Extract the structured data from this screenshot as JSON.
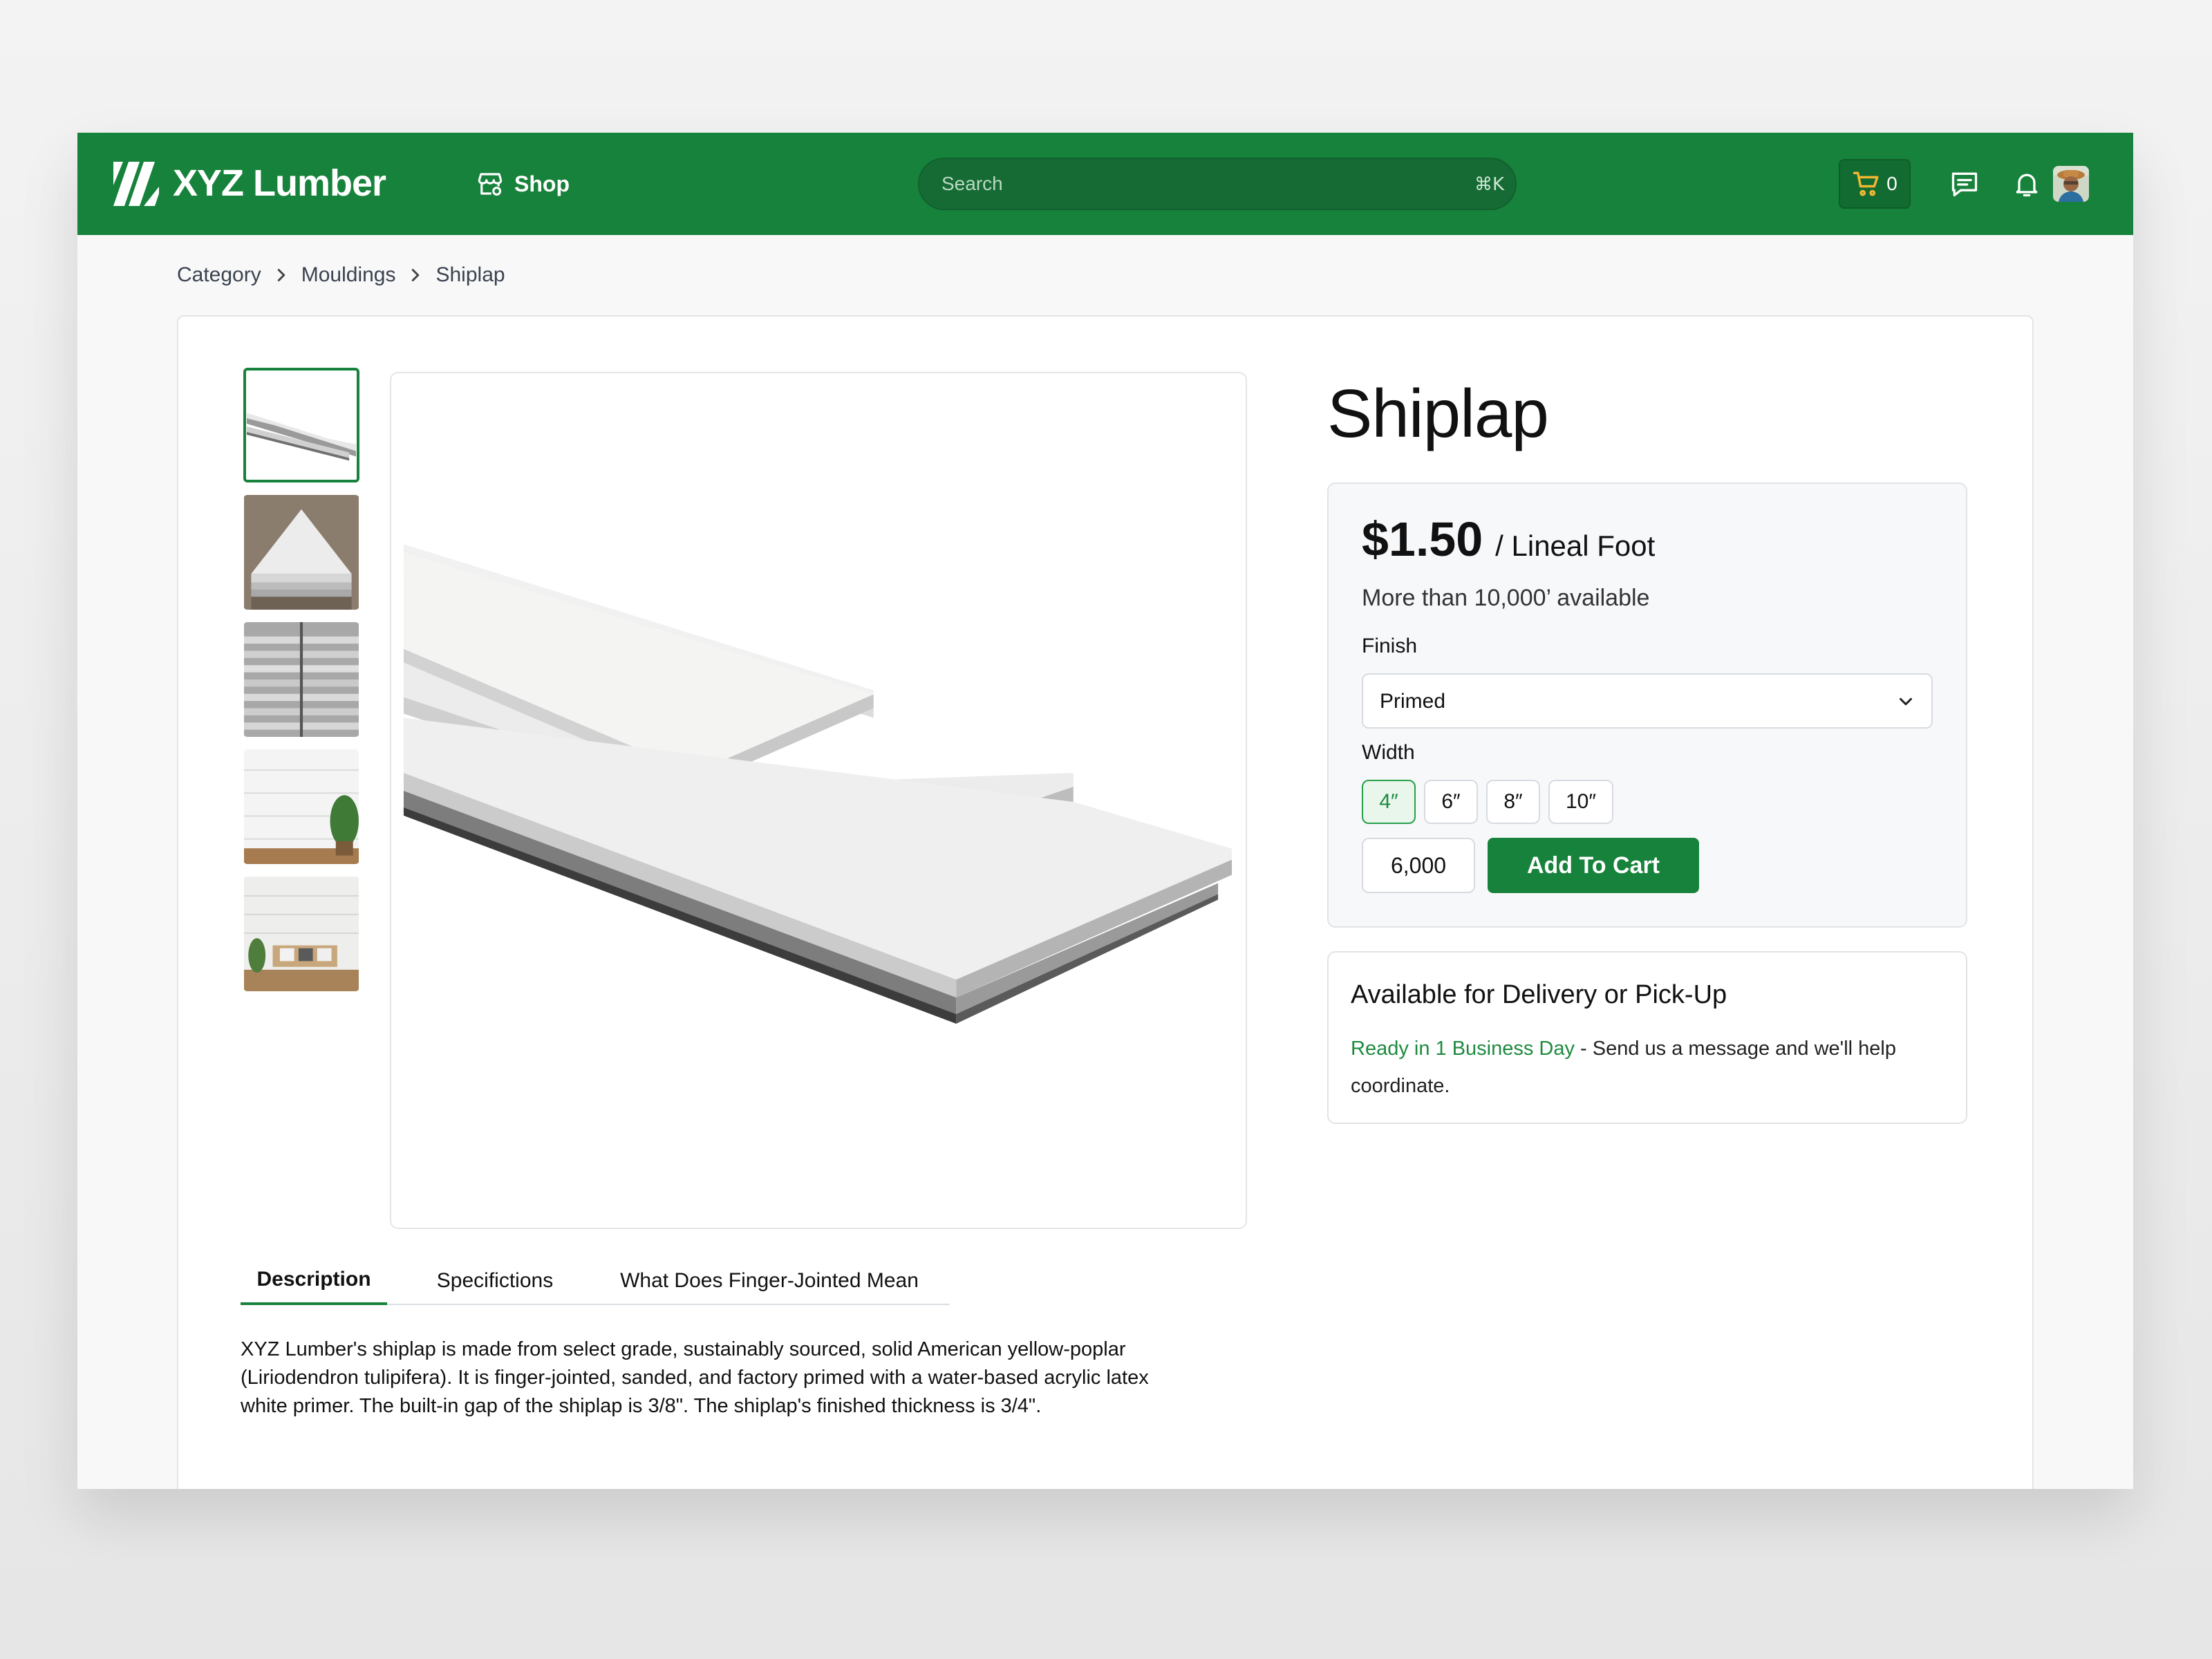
{
  "header": {
    "brand": "XYZ Lumber",
    "shop_label": "Shop",
    "search_placeholder": "Search",
    "search_shortcut": "⌘K",
    "cart_count": "0",
    "brand_color": "#17823b"
  },
  "breadcrumb": [
    "Category",
    "Mouldings",
    "Shiplap"
  ],
  "product": {
    "title": "Shiplap",
    "price": "$1.50",
    "price_unit": "/ Lineal Foot",
    "availability": "More than 10,000’ available",
    "finish_label": "Finish",
    "finish_value": "Primed",
    "width_label": "Width",
    "width_options": [
      "4″",
      "6″",
      "8″",
      "10″"
    ],
    "selected_width": "4″",
    "quantity": "6,000",
    "add_to_cart_label": "Add To Cart"
  },
  "delivery": {
    "title": "Available for Delivery or Pick-Up",
    "ready": "Ready in 1 Business Day",
    "message": " - Send us a message and we'll help coordinate."
  },
  "tabs": [
    "Description",
    "Specifictions",
    "What Does Finger-Jointed Mean"
  ],
  "active_tab": "Description",
  "description": "XYZ Lumber's shiplap is made from select grade, sustainably sourced, solid American yellow-poplar (Liriodendron tulipifera). It is finger-jointed, sanded, and factory primed with a water-based acrylic latex white primer. The built-in gap of the shiplap is 3/8\". The shiplap's finished thickness is 3/4\".",
  "icons": {
    "logo": "slash-stripes-logo-icon",
    "shop": "storefront-icon",
    "cart": "shopping-cart-icon",
    "messages": "chat-icon",
    "notifications": "bell-icon",
    "select": "chevron-down-icon",
    "breadcrumb_separator": "chevron-right-icon"
  }
}
